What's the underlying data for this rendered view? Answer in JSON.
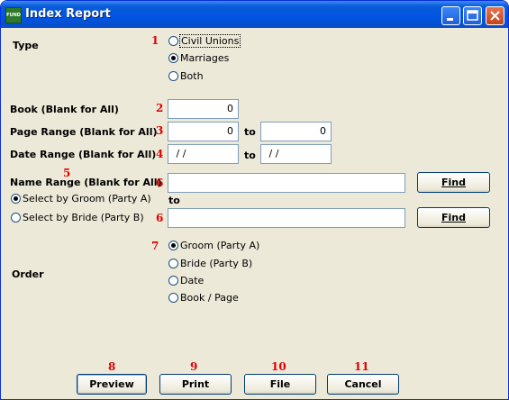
{
  "window": {
    "title": "Index Report",
    "icon_text": "FUND"
  },
  "markers": {
    "n1": "1",
    "n2": "2",
    "n3": "3",
    "n4": "4",
    "n5": "5",
    "n6a": "6",
    "n6b": "6",
    "n7": "7",
    "n8": "8",
    "n9": "9",
    "n10": "10",
    "n11": "11"
  },
  "type": {
    "label": "Type",
    "options": [
      "Civil Unions",
      "Marriages",
      "Both"
    ],
    "selected": "Marriages"
  },
  "book": {
    "label": "Book (Blank for All)",
    "value": "0"
  },
  "page_range": {
    "label": "Page Range (Blank for All)",
    "from": "0",
    "to_label": "to",
    "to": "0"
  },
  "date_range": {
    "label": "Date Range (Blank for All)",
    "from": " / /",
    "to_label": "to",
    "to": " / /"
  },
  "name_range": {
    "label": "Name Range (Blank for All)",
    "to_label": "to",
    "from_value": "",
    "to_value": "",
    "options": [
      "Select by Groom (Party A)",
      "Select by Bride (Party B)"
    ],
    "selected": "Select by Groom (Party A)",
    "find_label": "Find"
  },
  "order": {
    "label": "Order",
    "options": [
      "Groom (Party A)",
      "Bride (Party B)",
      "Date",
      "Book / Page"
    ],
    "selected": "Groom (Party A)"
  },
  "buttons": {
    "preview": "Preview",
    "print": "Print",
    "file": "File",
    "cancel": "Cancel"
  }
}
